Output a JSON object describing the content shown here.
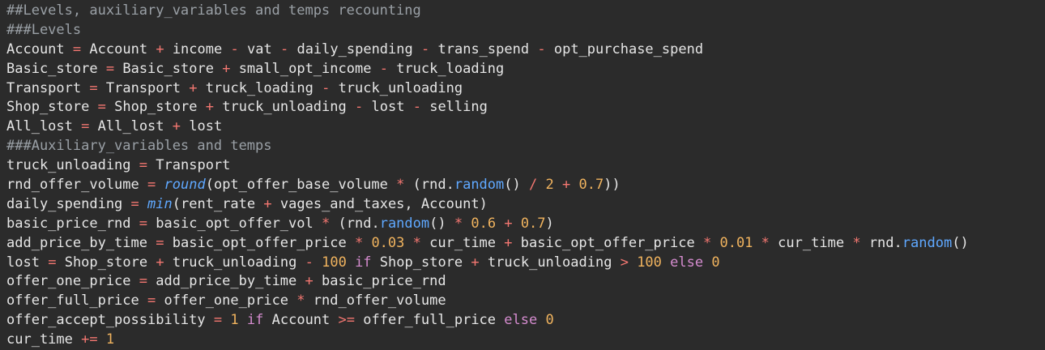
{
  "editor": {
    "lines": [
      [
        {
          "t": "comment",
          "v": "##Levels, auxiliary_variables and temps recounting"
        }
      ],
      [
        {
          "t": "comment",
          "v": "###Levels"
        }
      ],
      [
        {
          "t": "ident",
          "v": "Account"
        },
        {
          "t": "punct",
          "v": " "
        },
        {
          "t": "op",
          "v": "="
        },
        {
          "t": "punct",
          "v": " "
        },
        {
          "t": "ident",
          "v": "Account"
        },
        {
          "t": "punct",
          "v": " "
        },
        {
          "t": "op",
          "v": "+"
        },
        {
          "t": "punct",
          "v": " "
        },
        {
          "t": "ident",
          "v": "income"
        },
        {
          "t": "punct",
          "v": " "
        },
        {
          "t": "op",
          "v": "-"
        },
        {
          "t": "punct",
          "v": " "
        },
        {
          "t": "ident",
          "v": "vat"
        },
        {
          "t": "punct",
          "v": " "
        },
        {
          "t": "op",
          "v": "-"
        },
        {
          "t": "punct",
          "v": " "
        },
        {
          "t": "ident",
          "v": "daily_spending"
        },
        {
          "t": "punct",
          "v": " "
        },
        {
          "t": "op",
          "v": "-"
        },
        {
          "t": "punct",
          "v": " "
        },
        {
          "t": "ident",
          "v": "trans_spend"
        },
        {
          "t": "punct",
          "v": " "
        },
        {
          "t": "op",
          "v": "-"
        },
        {
          "t": "punct",
          "v": " "
        },
        {
          "t": "ident",
          "v": "opt_purchase_spend"
        }
      ],
      [
        {
          "t": "ident",
          "v": "Basic_store"
        },
        {
          "t": "punct",
          "v": " "
        },
        {
          "t": "op",
          "v": "="
        },
        {
          "t": "punct",
          "v": " "
        },
        {
          "t": "ident",
          "v": "Basic_store"
        },
        {
          "t": "punct",
          "v": " "
        },
        {
          "t": "op",
          "v": "+"
        },
        {
          "t": "punct",
          "v": " "
        },
        {
          "t": "ident",
          "v": "small_opt_income"
        },
        {
          "t": "punct",
          "v": " "
        },
        {
          "t": "op",
          "v": "-"
        },
        {
          "t": "punct",
          "v": " "
        },
        {
          "t": "ident",
          "v": "truck_loading"
        }
      ],
      [
        {
          "t": "ident",
          "v": "Transport"
        },
        {
          "t": "punct",
          "v": " "
        },
        {
          "t": "op",
          "v": "="
        },
        {
          "t": "punct",
          "v": " "
        },
        {
          "t": "ident",
          "v": "Transport"
        },
        {
          "t": "punct",
          "v": " "
        },
        {
          "t": "op",
          "v": "+"
        },
        {
          "t": "punct",
          "v": " "
        },
        {
          "t": "ident",
          "v": "truck_loading"
        },
        {
          "t": "punct",
          "v": " "
        },
        {
          "t": "op",
          "v": "-"
        },
        {
          "t": "punct",
          "v": " "
        },
        {
          "t": "ident",
          "v": "truck_unloading"
        }
      ],
      [
        {
          "t": "ident",
          "v": "Shop_store"
        },
        {
          "t": "punct",
          "v": " "
        },
        {
          "t": "op",
          "v": "="
        },
        {
          "t": "punct",
          "v": " "
        },
        {
          "t": "ident",
          "v": "Shop_store"
        },
        {
          "t": "punct",
          "v": " "
        },
        {
          "t": "op",
          "v": "+"
        },
        {
          "t": "punct",
          "v": " "
        },
        {
          "t": "ident",
          "v": "truck_unloading"
        },
        {
          "t": "punct",
          "v": " "
        },
        {
          "t": "op",
          "v": "-"
        },
        {
          "t": "punct",
          "v": " "
        },
        {
          "t": "ident",
          "v": "lost"
        },
        {
          "t": "punct",
          "v": " "
        },
        {
          "t": "op",
          "v": "-"
        },
        {
          "t": "punct",
          "v": " "
        },
        {
          "t": "ident",
          "v": "selling"
        }
      ],
      [
        {
          "t": "ident",
          "v": "All_lost"
        },
        {
          "t": "punct",
          "v": " "
        },
        {
          "t": "op",
          "v": "="
        },
        {
          "t": "punct",
          "v": " "
        },
        {
          "t": "ident",
          "v": "All_lost"
        },
        {
          "t": "punct",
          "v": " "
        },
        {
          "t": "op",
          "v": "+"
        },
        {
          "t": "punct",
          "v": " "
        },
        {
          "t": "ident",
          "v": "lost"
        }
      ],
      [
        {
          "t": "comment",
          "v": "###Auxiliary_variables and temps"
        }
      ],
      [
        {
          "t": "ident",
          "v": "truck_unloading"
        },
        {
          "t": "punct",
          "v": " "
        },
        {
          "t": "op",
          "v": "="
        },
        {
          "t": "punct",
          "v": " "
        },
        {
          "t": "ident",
          "v": "Transport"
        }
      ],
      [
        {
          "t": "ident",
          "v": "rnd_offer_volume"
        },
        {
          "t": "punct",
          "v": " "
        },
        {
          "t": "op",
          "v": "="
        },
        {
          "t": "punct",
          "v": " "
        },
        {
          "t": "builtin",
          "v": "round"
        },
        {
          "t": "punct",
          "v": "("
        },
        {
          "t": "ident",
          "v": "opt_offer_base_volume"
        },
        {
          "t": "punct",
          "v": " "
        },
        {
          "t": "op",
          "v": "*"
        },
        {
          "t": "punct",
          "v": " ("
        },
        {
          "t": "ident",
          "v": "rnd"
        },
        {
          "t": "punct",
          "v": "."
        },
        {
          "t": "method",
          "v": "random"
        },
        {
          "t": "punct",
          "v": "() "
        },
        {
          "t": "op",
          "v": "/"
        },
        {
          "t": "punct",
          "v": " "
        },
        {
          "t": "num",
          "v": "2"
        },
        {
          "t": "punct",
          "v": " "
        },
        {
          "t": "op",
          "v": "+"
        },
        {
          "t": "punct",
          "v": " "
        },
        {
          "t": "num",
          "v": "0.7"
        },
        {
          "t": "punct",
          "v": "))"
        }
      ],
      [
        {
          "t": "ident",
          "v": "daily_spending"
        },
        {
          "t": "punct",
          "v": " "
        },
        {
          "t": "op",
          "v": "="
        },
        {
          "t": "punct",
          "v": " "
        },
        {
          "t": "builtin",
          "v": "min"
        },
        {
          "t": "punct",
          "v": "("
        },
        {
          "t": "ident",
          "v": "rent_rate"
        },
        {
          "t": "punct",
          "v": " "
        },
        {
          "t": "op",
          "v": "+"
        },
        {
          "t": "punct",
          "v": " "
        },
        {
          "t": "ident",
          "v": "vages_and_taxes"
        },
        {
          "t": "punct",
          "v": ", "
        },
        {
          "t": "ident",
          "v": "Account"
        },
        {
          "t": "punct",
          "v": ")"
        }
      ],
      [
        {
          "t": "ident",
          "v": "basic_price_rnd"
        },
        {
          "t": "punct",
          "v": " "
        },
        {
          "t": "op",
          "v": "="
        },
        {
          "t": "punct",
          "v": " "
        },
        {
          "t": "ident",
          "v": "basic_opt_offer_vol"
        },
        {
          "t": "punct",
          "v": " "
        },
        {
          "t": "op",
          "v": "*"
        },
        {
          "t": "punct",
          "v": " ("
        },
        {
          "t": "ident",
          "v": "rnd"
        },
        {
          "t": "punct",
          "v": "."
        },
        {
          "t": "method",
          "v": "random"
        },
        {
          "t": "punct",
          "v": "() "
        },
        {
          "t": "op",
          "v": "*"
        },
        {
          "t": "punct",
          "v": " "
        },
        {
          "t": "num",
          "v": "0.6"
        },
        {
          "t": "punct",
          "v": " "
        },
        {
          "t": "op",
          "v": "+"
        },
        {
          "t": "punct",
          "v": " "
        },
        {
          "t": "num",
          "v": "0.7"
        },
        {
          "t": "punct",
          "v": ")"
        }
      ],
      [
        {
          "t": "ident",
          "v": "add_price_by_time"
        },
        {
          "t": "punct",
          "v": " "
        },
        {
          "t": "op",
          "v": "="
        },
        {
          "t": "punct",
          "v": " "
        },
        {
          "t": "ident",
          "v": "basic_opt_offer_price"
        },
        {
          "t": "punct",
          "v": " "
        },
        {
          "t": "op",
          "v": "*"
        },
        {
          "t": "punct",
          "v": " "
        },
        {
          "t": "num",
          "v": "0.03"
        },
        {
          "t": "punct",
          "v": " "
        },
        {
          "t": "op",
          "v": "*"
        },
        {
          "t": "punct",
          "v": " "
        },
        {
          "t": "ident",
          "v": "cur_time"
        },
        {
          "t": "punct",
          "v": " "
        },
        {
          "t": "op",
          "v": "+"
        },
        {
          "t": "punct",
          "v": " "
        },
        {
          "t": "ident",
          "v": "basic_opt_offer_price"
        },
        {
          "t": "punct",
          "v": " "
        },
        {
          "t": "op",
          "v": "*"
        },
        {
          "t": "punct",
          "v": " "
        },
        {
          "t": "num",
          "v": "0.01"
        },
        {
          "t": "punct",
          "v": " "
        },
        {
          "t": "op",
          "v": "*"
        },
        {
          "t": "punct",
          "v": " "
        },
        {
          "t": "ident",
          "v": "cur_time"
        },
        {
          "t": "punct",
          "v": " "
        },
        {
          "t": "op",
          "v": "*"
        },
        {
          "t": "punct",
          "v": " "
        },
        {
          "t": "ident",
          "v": "rnd"
        },
        {
          "t": "punct",
          "v": "."
        },
        {
          "t": "method",
          "v": "random"
        },
        {
          "t": "punct",
          "v": "()"
        }
      ],
      [
        {
          "t": "ident",
          "v": "lost"
        },
        {
          "t": "punct",
          "v": " "
        },
        {
          "t": "op",
          "v": "="
        },
        {
          "t": "punct",
          "v": " "
        },
        {
          "t": "ident",
          "v": "Shop_store"
        },
        {
          "t": "punct",
          "v": " "
        },
        {
          "t": "op",
          "v": "+"
        },
        {
          "t": "punct",
          "v": " "
        },
        {
          "t": "ident",
          "v": "truck_unloading"
        },
        {
          "t": "punct",
          "v": " "
        },
        {
          "t": "op",
          "v": "-"
        },
        {
          "t": "punct",
          "v": " "
        },
        {
          "t": "num",
          "v": "100"
        },
        {
          "t": "punct",
          "v": " "
        },
        {
          "t": "keyword",
          "v": "if"
        },
        {
          "t": "punct",
          "v": " "
        },
        {
          "t": "ident",
          "v": "Shop_store"
        },
        {
          "t": "punct",
          "v": " "
        },
        {
          "t": "op",
          "v": "+"
        },
        {
          "t": "punct",
          "v": " "
        },
        {
          "t": "ident",
          "v": "truck_unloading"
        },
        {
          "t": "punct",
          "v": " "
        },
        {
          "t": "op",
          "v": ">"
        },
        {
          "t": "punct",
          "v": " "
        },
        {
          "t": "num",
          "v": "100"
        },
        {
          "t": "punct",
          "v": " "
        },
        {
          "t": "keyword",
          "v": "else"
        },
        {
          "t": "punct",
          "v": " "
        },
        {
          "t": "num",
          "v": "0"
        }
      ],
      [
        {
          "t": "ident",
          "v": "offer_one_price"
        },
        {
          "t": "punct",
          "v": " "
        },
        {
          "t": "op",
          "v": "="
        },
        {
          "t": "punct",
          "v": " "
        },
        {
          "t": "ident",
          "v": "add_price_by_time"
        },
        {
          "t": "punct",
          "v": " "
        },
        {
          "t": "op",
          "v": "+"
        },
        {
          "t": "punct",
          "v": " "
        },
        {
          "t": "ident",
          "v": "basic_price_rnd"
        }
      ],
      [
        {
          "t": "ident",
          "v": "offer_full_price"
        },
        {
          "t": "punct",
          "v": " "
        },
        {
          "t": "op",
          "v": "="
        },
        {
          "t": "punct",
          "v": " "
        },
        {
          "t": "ident",
          "v": "offer_one_price"
        },
        {
          "t": "punct",
          "v": " "
        },
        {
          "t": "op",
          "v": "*"
        },
        {
          "t": "punct",
          "v": " "
        },
        {
          "t": "ident",
          "v": "rnd_offer_volume"
        }
      ],
      [
        {
          "t": "ident",
          "v": "offer_accept_possibility"
        },
        {
          "t": "punct",
          "v": " "
        },
        {
          "t": "op",
          "v": "="
        },
        {
          "t": "punct",
          "v": " "
        },
        {
          "t": "num",
          "v": "1"
        },
        {
          "t": "punct",
          "v": " "
        },
        {
          "t": "keyword",
          "v": "if"
        },
        {
          "t": "punct",
          "v": " "
        },
        {
          "t": "ident",
          "v": "Account"
        },
        {
          "t": "punct",
          "v": " "
        },
        {
          "t": "op",
          "v": ">="
        },
        {
          "t": "punct",
          "v": " "
        },
        {
          "t": "ident",
          "v": "offer_full_price"
        },
        {
          "t": "punct",
          "v": " "
        },
        {
          "t": "keyword",
          "v": "else"
        },
        {
          "t": "punct",
          "v": " "
        },
        {
          "t": "num",
          "v": "0"
        }
      ],
      [
        {
          "t": "ident",
          "v": "cur_time"
        },
        {
          "t": "punct",
          "v": " "
        },
        {
          "t": "op",
          "v": "+="
        },
        {
          "t": "punct",
          "v": " "
        },
        {
          "t": "num",
          "v": "1"
        }
      ]
    ]
  },
  "colors": {
    "background": "#2b2b2b",
    "text": "#e6e6e6",
    "comment": "#9aa0a6",
    "operator": "#f47771",
    "number": "#f0b35e",
    "builtin": "#5fa8ff",
    "keyword": "#d58ccf"
  }
}
